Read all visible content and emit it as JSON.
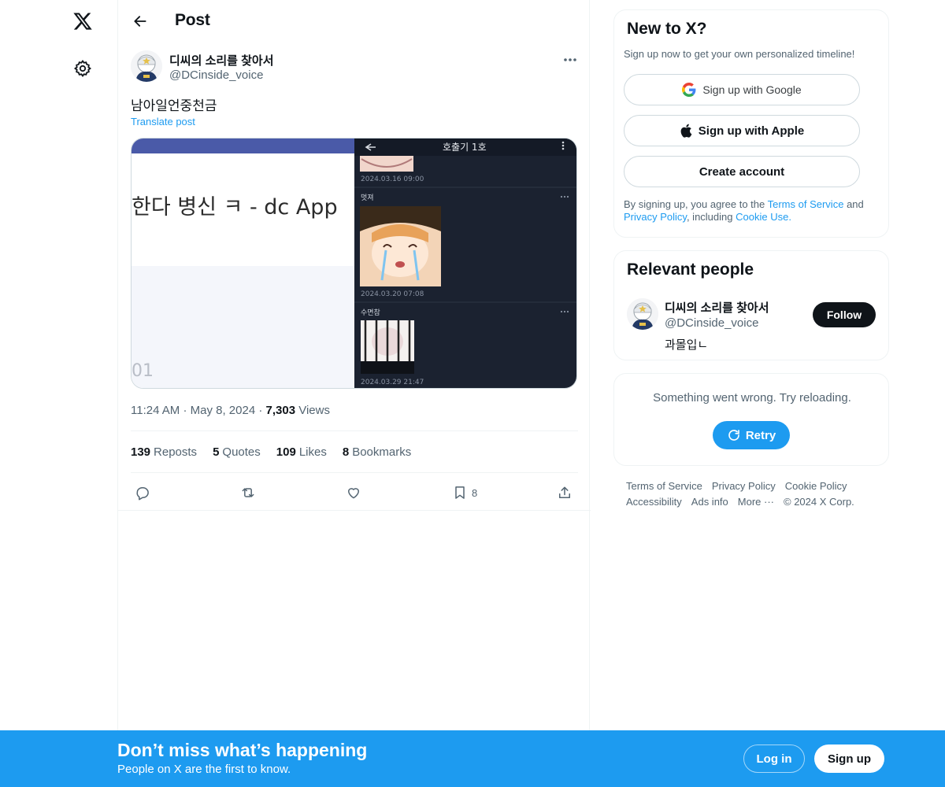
{
  "nav": {
    "logo_icon": "x-logo-icon",
    "settings_icon": "gear-icon"
  },
  "header": {
    "title": "Post"
  },
  "post": {
    "author_name": "디씨의 소리를 찾아서",
    "author_handle": "@DCinside_voice",
    "text": "남아일언중천금",
    "translate_label": "Translate post",
    "media_left_text": "한다 병신 ㅋ - dc App",
    "media_left_corner": "01",
    "media_right": {
      "title": "호출기 1호",
      "date_top": "2024.03.16 09:00",
      "item1_name": "멋져",
      "item1_date": "2024.03.20 07:08",
      "item2_name": "수면참",
      "item2_date": "2024.03.29 21:47"
    },
    "time": "11:24 AM",
    "date": "May 8, 2024",
    "views_count": "7,303",
    "views_label": "Views",
    "reposts_count": "139",
    "reposts_label": "Reposts",
    "quotes_count": "5",
    "quotes_label": "Quotes",
    "likes_count": "109",
    "likes_label": "Likes",
    "bookmarks_count": "8",
    "bookmarks_label": "Bookmarks",
    "bookmark_action_count": "8"
  },
  "signup_card": {
    "title": "New to X?",
    "subtitle": "Sign up now to get your own personalized timeline!",
    "google_label": "Sign up with Google",
    "apple_label": "Sign up with Apple",
    "create_label": "Create account",
    "legal_prefix": "By signing up, you agree to the",
    "tos": "Terms of Service",
    "and": "and",
    "privacy": "Privacy Policy",
    "including": ", including",
    "cookie": "Cookie Use."
  },
  "relevant": {
    "title": "Relevant people",
    "name": "디씨의 소리를 찾아서",
    "handle": "@DCinside_voice",
    "bio": "과몰입ㄴ",
    "follow_label": "Follow"
  },
  "error_card": {
    "message": "Something went wrong. Try reloading.",
    "retry_label": "Retry"
  },
  "footer": {
    "links_row1": [
      "Terms of Service",
      "Privacy Policy",
      "Cookie Policy"
    ],
    "links_row2": [
      "Accessibility",
      "Ads info",
      "More ···",
      "© 2024 X Corp."
    ]
  },
  "banner": {
    "title": "Don’t miss what’s happening",
    "subtitle": "People on X are the first to know.",
    "login_label": "Log in",
    "signup_label": "Sign up"
  },
  "colors": {
    "accent": "#1d9bf0",
    "text": "#0f1419",
    "muted": "#536471"
  }
}
